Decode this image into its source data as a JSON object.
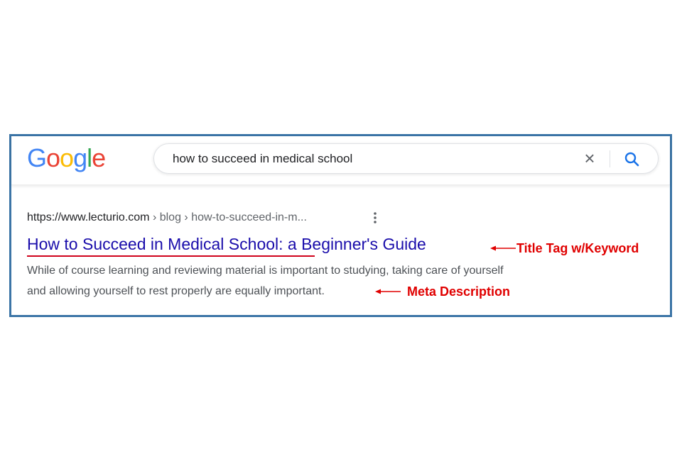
{
  "logo": {
    "text": "Google",
    "letters": [
      {
        "ch": "G",
        "color": "#4285F4"
      },
      {
        "ch": "o",
        "color": "#EA4335"
      },
      {
        "ch": "o",
        "color": "#FBBC05"
      },
      {
        "ch": "g",
        "color": "#4285F4"
      },
      {
        "ch": "l",
        "color": "#34A853"
      },
      {
        "ch": "e",
        "color": "#EA4335"
      }
    ]
  },
  "search": {
    "value": "how to succeed in medical school",
    "clear_icon": "close-icon",
    "search_icon": "search-icon",
    "accent": "#1a73e8"
  },
  "result": {
    "domain": "https://www.lecturio.com",
    "path": " › blog › how-to-succeed-in-m...",
    "more_icon": "more-vert-icon",
    "title": "How to Succeed in Medical School: a Beginner's Guide",
    "title_color": "#1a0dab",
    "description_line1": "While of course learning and reviewing material is important to studying, taking care of yourself",
    "description_line2": "and allowing yourself to rest properly are equally important."
  },
  "annotations": {
    "title_tag": "Title Tag w/Keyword",
    "meta_description": "Meta Description",
    "color": "#e00000"
  }
}
